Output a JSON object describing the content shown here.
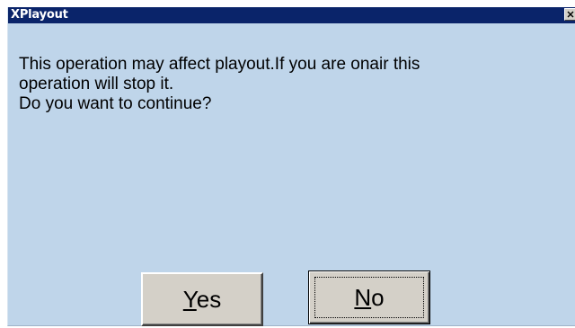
{
  "window": {
    "title": "XPlayout",
    "close_icon": "close-x-icon"
  },
  "message": {
    "line1": "This operation may affect playout.If you are onair this",
    "line2": "operation will stop it.",
    "line3": "Do you want to continue?"
  },
  "buttons": {
    "yes": {
      "mnemonic": "Y",
      "rest": "es"
    },
    "no": {
      "mnemonic": "N",
      "rest": "o"
    }
  },
  "colors": {
    "dialog_background": "#bfd5ea",
    "titlebar": "#0a246a",
    "button_face": "#d4d0c8"
  }
}
